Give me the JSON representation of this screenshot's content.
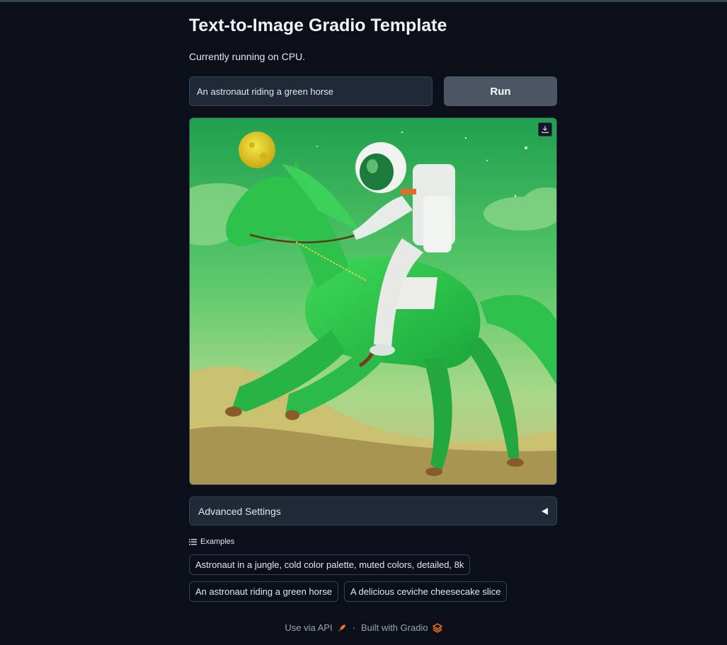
{
  "app": {
    "title": "Text-to-Image Gradio Template",
    "subtitle": "Currently running on CPU."
  },
  "prompt": {
    "value": "An astronaut riding a green horse"
  },
  "run_button": {
    "label": "Run"
  },
  "output_image": {
    "subject": "astronaut riding a green horse, green sky with yellow moon"
  },
  "advanced_settings": {
    "label": "Advanced Settings",
    "expanded": false
  },
  "examples": {
    "header": "Examples",
    "items": [
      "Astronaut in a jungle, cold color palette, muted colors, detailed, 8k",
      "An astronaut riding a green horse",
      "A delicious ceviche cheesecake slice"
    ]
  },
  "footer": {
    "api_link": "Use via API",
    "separator": "·",
    "built_with": "Built with Gradio"
  },
  "colors": {
    "background": "#0b0f19",
    "panel": "#1f2937",
    "border": "#374151",
    "button": "#4b5563",
    "gradio_orange": "#f97316"
  }
}
